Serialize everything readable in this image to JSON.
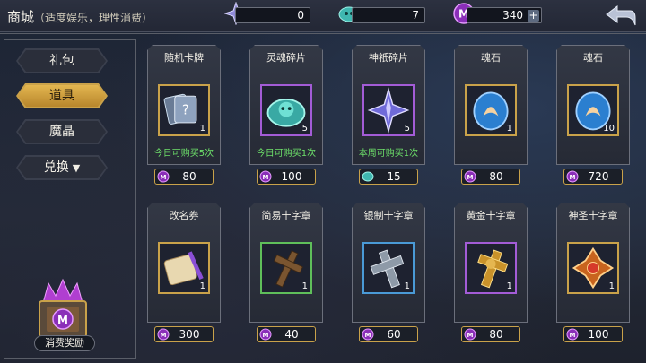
{
  "header": {
    "title": "商城",
    "subtitle": "（适度娱乐，理性消费）",
    "resources": [
      {
        "icon": "star-shard-icon",
        "value": "0"
      },
      {
        "icon": "soul-token-icon",
        "value": "7"
      },
      {
        "icon": "magic-crystal-icon",
        "value": "340"
      }
    ]
  },
  "nav": {
    "items": [
      {
        "label": "礼包",
        "active": false
      },
      {
        "label": "道具",
        "active": true
      },
      {
        "label": "魔晶",
        "active": false
      },
      {
        "label": "兑换",
        "active": false,
        "dropdown": true
      }
    ],
    "reward_label": "消费奖励"
  },
  "items": [
    {
      "name": "随机卡牌",
      "qty": "1",
      "limit": "今日可购买5次",
      "price": "80",
      "currency": "magic-crystal-icon",
      "rarity": "#c9a24a",
      "icon": "card-pack-icon"
    },
    {
      "name": "灵魂碎片",
      "qty": "5",
      "limit": "今日可购买1次",
      "price": "100",
      "currency": "magic-crystal-icon",
      "rarity": "#a35cd6",
      "icon": "soul-shard-icon"
    },
    {
      "name": "神祇碎片",
      "qty": "5",
      "limit": "本周可购买1次",
      "price": "15",
      "currency": "soul-token-icon",
      "rarity": "#a35cd6",
      "icon": "divine-shard-icon"
    },
    {
      "name": "魂石",
      "qty": "1",
      "limit": "",
      "price": "80",
      "currency": "magic-crystal-icon",
      "rarity": "#c9a24a",
      "icon": "soul-stone-icon"
    },
    {
      "name": "魂石",
      "qty": "10",
      "limit": "",
      "price": "720",
      "currency": "magic-crystal-icon",
      "rarity": "#c9a24a",
      "icon": "soul-stone-icon"
    },
    {
      "name": "改名券",
      "qty": "1",
      "limit": "",
      "price": "300",
      "currency": "magic-crystal-icon",
      "rarity": "#c9a24a",
      "icon": "rename-scroll-icon"
    },
    {
      "name": "简易十字章",
      "qty": "1",
      "limit": "",
      "price": "40",
      "currency": "magic-crystal-icon",
      "rarity": "#5fbf5a",
      "icon": "wooden-cross-icon"
    },
    {
      "name": "银制十字章",
      "qty": "1",
      "limit": "",
      "price": "60",
      "currency": "magic-crystal-icon",
      "rarity": "#4a9ad6",
      "icon": "silver-cross-icon"
    },
    {
      "name": "黄金十字章",
      "qty": "1",
      "limit": "",
      "price": "80",
      "currency": "magic-crystal-icon",
      "rarity": "#a35cd6",
      "icon": "gold-cross-icon"
    },
    {
      "name": "神圣十字章",
      "qty": "1",
      "limit": "",
      "price": "100",
      "currency": "magic-crystal-icon",
      "rarity": "#c9a24a",
      "icon": "holy-cross-icon"
    }
  ]
}
